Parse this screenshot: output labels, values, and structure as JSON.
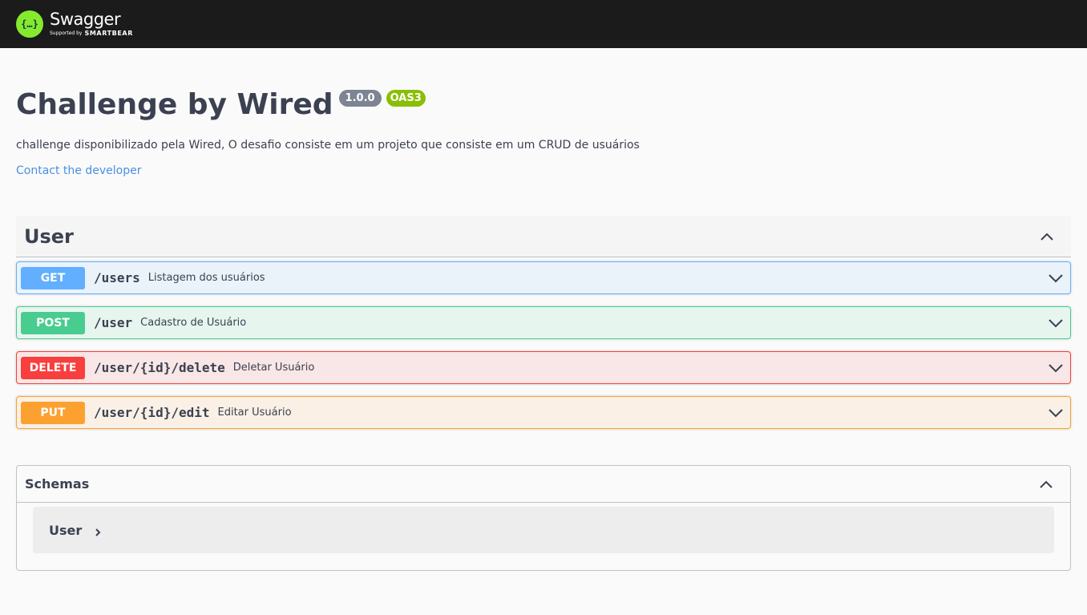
{
  "topbar": {
    "logo_glyph": "{…}",
    "brand": "Swagger",
    "supported_by": "Supported by",
    "company": "SMARTBEAR"
  },
  "info": {
    "title": "Challenge by Wired",
    "version": "1.0.0",
    "oas": "OAS3",
    "description": "challenge disponibilizado pela Wired, O desafio consiste em um projeto que consiste em um CRUD de usuários",
    "contact": "Contact the developer"
  },
  "tag": {
    "name": "User",
    "operations": [
      {
        "method": "GET",
        "path": "/users",
        "summary": "Listagem dos usuários",
        "color": "#61affe"
      },
      {
        "method": "POST",
        "path": "/user",
        "summary": "Cadastro de Usuário",
        "color": "#49cc90"
      },
      {
        "method": "DELETE",
        "path": "/user/{id}/delete",
        "summary": "Deletar Usuário",
        "color": "#f93e3e"
      },
      {
        "method": "PUT",
        "path": "/user/{id}/edit",
        "summary": "Editar Usuário",
        "color": "#fca130"
      }
    ]
  },
  "schemas": {
    "title": "Schemas",
    "models": [
      {
        "name": "User"
      }
    ]
  },
  "icons": {
    "collapse": "chevron-up-icon",
    "expand": "chevron-down-icon",
    "model_expand": "chevron-right-icon"
  }
}
